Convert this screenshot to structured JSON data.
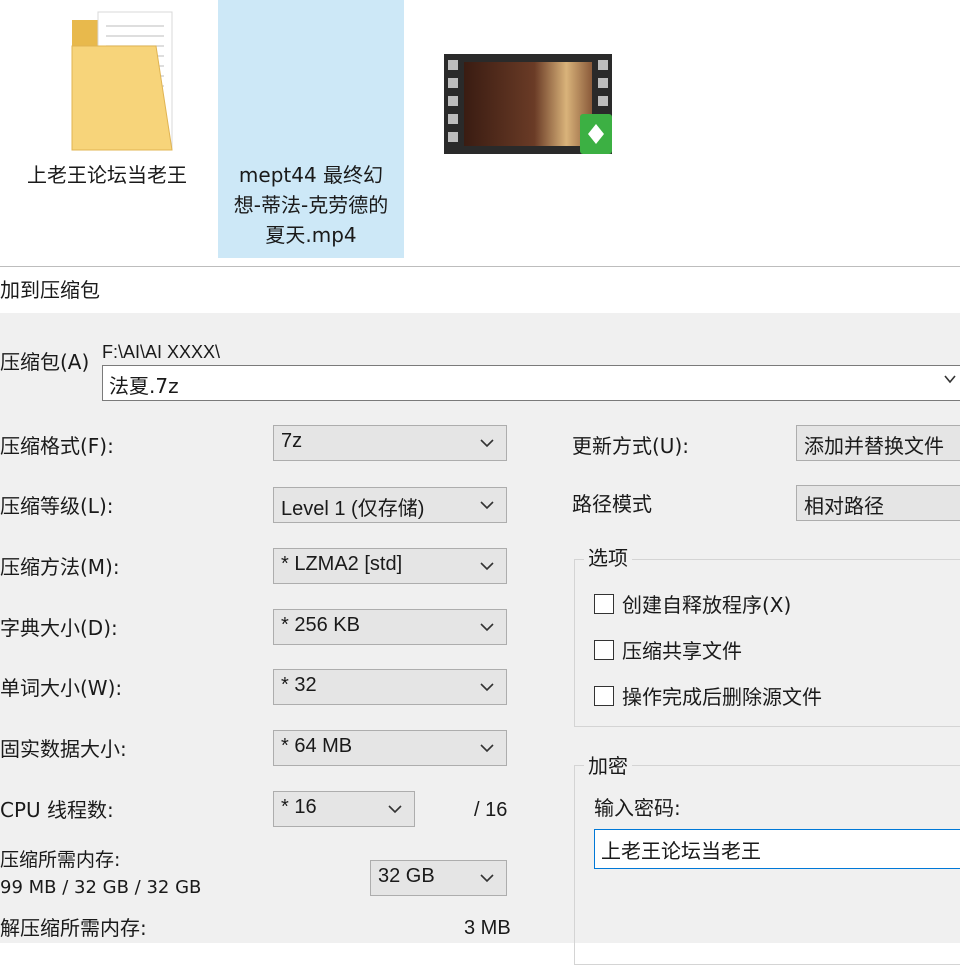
{
  "desktop": {
    "folder": {
      "label": "上老王论坛当老王",
      "icon": "folder-icon"
    },
    "video": {
      "label": "mept44 最终幻想-蒂法-克劳德的夏天.mp4",
      "icon": "video-file-icon"
    }
  },
  "dialog": {
    "title": "加到压缩包",
    "archive": {
      "label": "压缩包(A)",
      "path": "F:\\AI\\AI XXXX\\",
      "value": "法夏.7z"
    },
    "left": {
      "format": {
        "label": "压缩格式(F):",
        "value": "7z"
      },
      "level": {
        "label": "压缩等级(L):",
        "value": "Level 1 (仅存储)"
      },
      "method": {
        "label": "压缩方法(M):",
        "value": "* LZMA2 [std]"
      },
      "dict": {
        "label": "字典大小(D):",
        "value": "* 256 KB"
      },
      "word": {
        "label": "单词大小(W):",
        "value": "* 32"
      },
      "solid": {
        "label": "固实数据大小:",
        "value": "* 64 MB"
      },
      "threads": {
        "label": "CPU 线程数:",
        "value": "* 16",
        "max": "/ 16"
      },
      "mem_comp": {
        "label": "压缩所需内存:",
        "detail": "99 MB / 32 GB / 32 GB",
        "value": "32 GB"
      },
      "mem_decomp": {
        "label": "解压缩所需内存:",
        "value": "3 MB"
      }
    },
    "right": {
      "update": {
        "label": "更新方式(U):",
        "value": "添加并替换文件"
      },
      "pathmode": {
        "label": "路径模式",
        "value": "相对路径"
      },
      "options": {
        "title": "选项",
        "items": [
          "创建自释放程序(X)",
          "压缩共享文件",
          "操作完成后删除源文件"
        ]
      },
      "encryption": {
        "title": "加密",
        "password_label": "输入密码:",
        "password_value": "上老王论坛当老王"
      }
    }
  }
}
